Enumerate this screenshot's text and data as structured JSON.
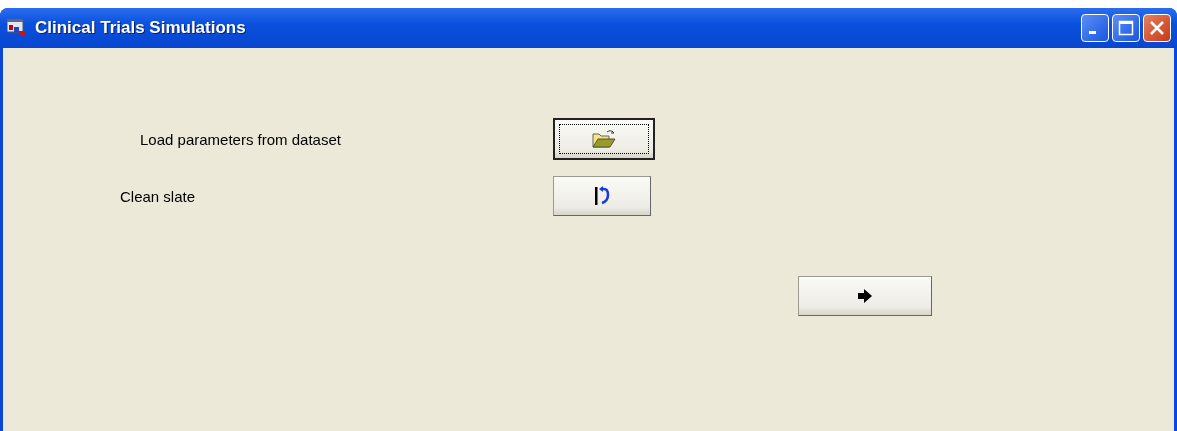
{
  "window": {
    "title": "Clinical Trials Simulations"
  },
  "actions": [
    {
      "label": "Load parameters from dataset",
      "kind": "open",
      "focused": true
    },
    {
      "label": "Clean slate",
      "kind": "reset",
      "focused": false
    }
  ],
  "next_button": {
    "kind": "next",
    "focused": false
  }
}
